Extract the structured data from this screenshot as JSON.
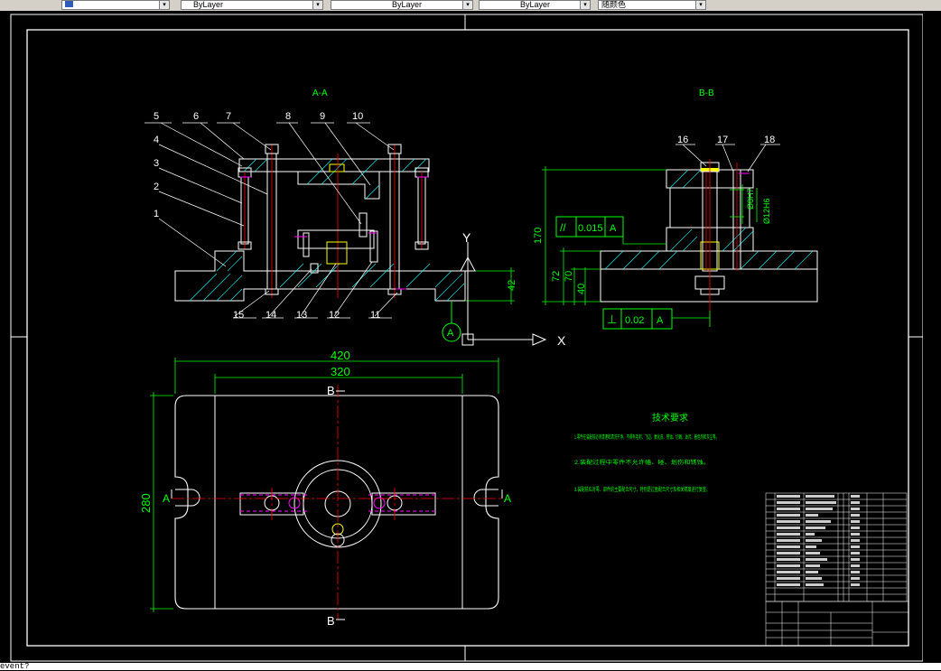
{
  "toolbar": {
    "layer_value": "",
    "color_value": "ByLayer",
    "linetype_value": "ByLayer",
    "lineweight_value": "ByLayer",
    "plotstyle_value": "随颜色"
  },
  "drawing": {
    "view_aa_label": "A-A",
    "view_bb_label": "B-B",
    "part_numbers_top": [
      "5",
      "6",
      "7",
      "8",
      "9",
      "10"
    ],
    "part_numbers_left": [
      "4",
      "3",
      "2",
      "1"
    ],
    "part_numbers_bottom": [
      "15",
      "14",
      "13",
      "12",
      "11"
    ],
    "part_numbers_bb": [
      "16",
      "17",
      "18"
    ],
    "dim_170": "170",
    "dim_72": "72",
    "dim_70": "70",
    "dim_40": "40",
    "dim_42": "42",
    "dim_d8": "Ø8H7",
    "dim_d12": "Ø12H6",
    "tol_parallel_sym": "//",
    "tol_parallel_val": "0.015",
    "tol_parallel_ref": "A",
    "tol_perp_sym": "⊥",
    "tol_perp_val": "0.02",
    "tol_perp_ref": "A",
    "datum_label": "A",
    "axis_y": "Y",
    "axis_x": "X",
    "dim_420": "420",
    "dim_320": "320",
    "dim_280": "280",
    "section_b_top": "B",
    "section_b_bottom": "B",
    "section_a_left": "A",
    "section_a_right": "A"
  },
  "tech_req": {
    "title": "技术要求",
    "items": [
      "1.零件在装配前必须清理和清洗干净，不得有毛刺、飞边、氧化皮、锈蚀、切屑、油污、着色剂和灰尘等。",
      "2.装配过程中零件不允许磕、碰、划伤和锈蚀。",
      "3.装配前应对零、部件的主要配合尺寸，特别是过盈配合尺寸及相关精度进行复查。"
    ]
  },
  "command_line": {
    "text": "event?"
  },
  "colors": {
    "line_white": "#ffffff",
    "line_green": "#00ff00",
    "line_red": "#ff0000",
    "line_yellow": "#ffff00",
    "line_magenta": "#ff00ff",
    "hatch_cyan": "#00ffff"
  }
}
